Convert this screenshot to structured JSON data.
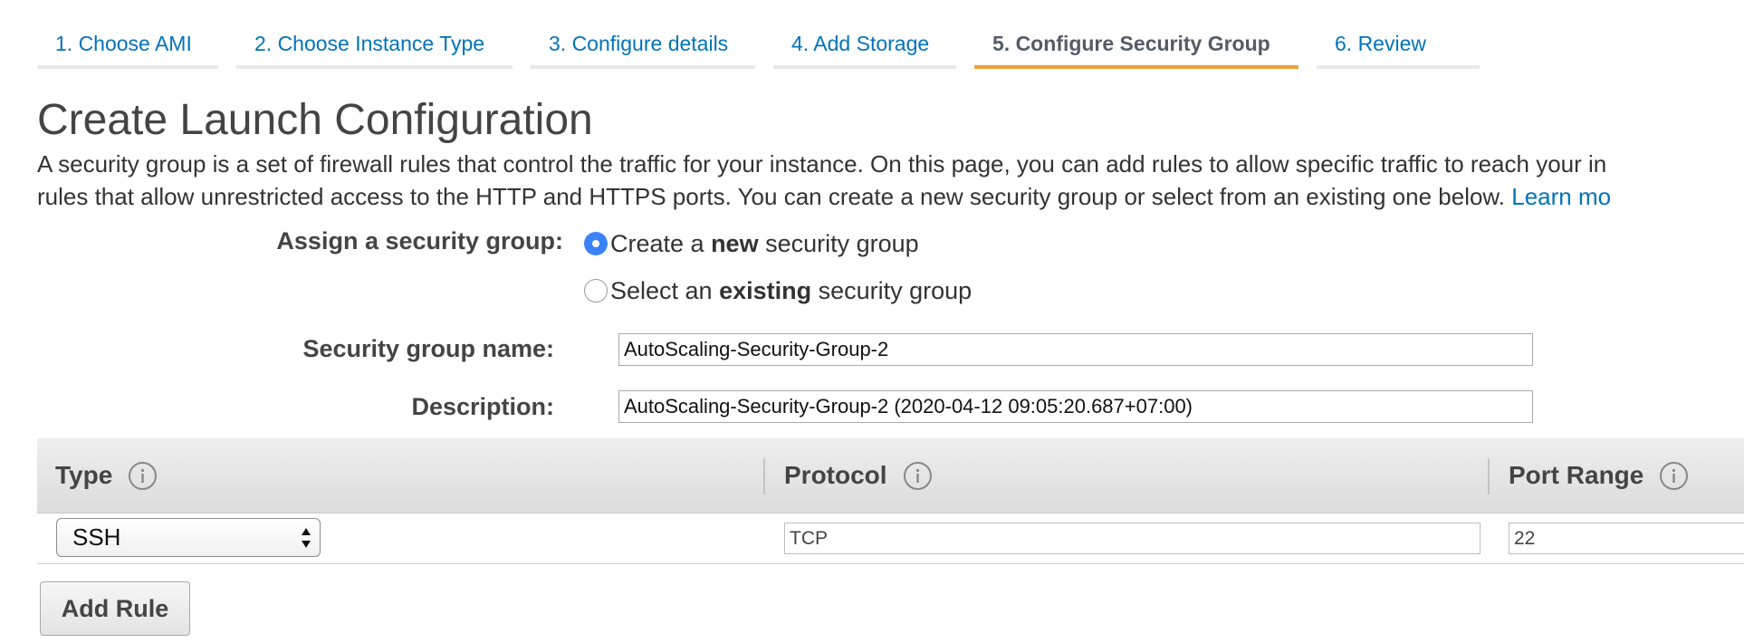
{
  "wizard": {
    "tabs": [
      {
        "label": "1. Choose AMI",
        "active": false
      },
      {
        "label": "2. Choose Instance Type",
        "active": false
      },
      {
        "label": "3. Configure details",
        "active": false
      },
      {
        "label": "4. Add Storage",
        "active": false
      },
      {
        "label": "5. Configure Security Group",
        "active": true
      },
      {
        "label": "6. Review",
        "active": false
      }
    ]
  },
  "page": {
    "title": "Create Launch Configuration",
    "intro_line1": "A security group is a set of firewall rules that control the traffic for your instance. On this page, you can add rules to allow specific traffic to reach your in",
    "intro_line2": "rules that allow unrestricted access to the HTTP and HTTPS ports. You can create a new security group or select from an existing one below.",
    "learn_more": "Learn mo"
  },
  "form": {
    "assign_label": "Assign a security group:",
    "option_new": {
      "prefix": "Create a ",
      "bold": "new",
      "suffix": " security group",
      "selected": true
    },
    "option_existing": {
      "prefix": "Select an ",
      "bold": "existing",
      "suffix": " security group",
      "selected": false
    },
    "name_label": "Security group name:",
    "name_value": "AutoScaling-Security-Group-2",
    "description_label": "Description:",
    "description_value": "AutoScaling-Security-Group-2 (2020-04-12 09:05:20.687+07:00)"
  },
  "rules_table": {
    "columns": [
      "Type",
      "Protocol",
      "Port Range"
    ],
    "rows": [
      {
        "type": "SSH",
        "protocol": "TCP",
        "port_range": "22"
      }
    ]
  },
  "buttons": {
    "add_rule": "Add Rule"
  },
  "colors": {
    "link": "#0073bb",
    "active_tab_accent": "#f0a035",
    "radio_selected": "#3b82f6"
  }
}
